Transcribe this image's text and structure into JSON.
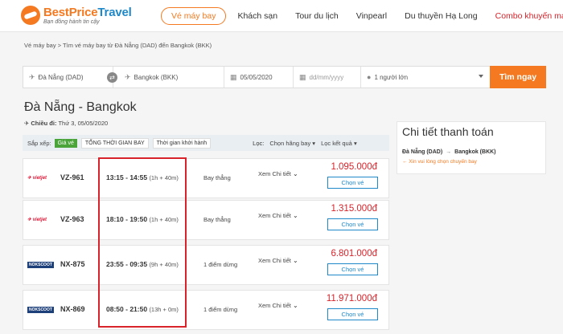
{
  "header": {
    "brand_main": "BestPrice",
    "brand_second": "Travel",
    "tagline": "Bạn đồng hành tin cậy",
    "nav": [
      "Vé máy bay",
      "Khách sạn",
      "Tour du lịch",
      "Vinpearl",
      "Du thuyền Hạ Long",
      "Combo khuyến mại"
    ]
  },
  "breadcrumb": {
    "home": "Vé máy bay",
    "sep": ">",
    "current": "Tìm vé máy bay từ Đà Nẵng (DAD) đến Bangkok (BKK)"
  },
  "search": {
    "from": "Đà Nẵng (DAD)",
    "to": "Bangkok (BKK)",
    "depart_date": "05/05/2020",
    "return_placeholder": "dd/mm/yyyy",
    "passengers": "1 người lớn",
    "button": "Tìm ngay"
  },
  "results": {
    "title": "Đà Nẵng - Bangkok",
    "depart_label": "Chiều đi:",
    "depart_date": "Thứ 3, 05/05/2020",
    "sort_label": "Sắp xếp:",
    "sort_price": "Giá vé",
    "sort_total_time": "TỔNG THỜI GIAN BAY",
    "sort_depart_time": "Thời gian khởi hành",
    "filter_label": "Lọc:",
    "filter_airline": "Chọn hãng bay",
    "filter_result": "Lọc kết quả",
    "flights": [
      {
        "airline": "vietjet",
        "code": "VZ-961",
        "depart": "13:15",
        "arrive": "14:55",
        "duration": "(1h + 40m)",
        "stops": "Bay thẳng",
        "details": "Xem Chi tiết",
        "price": "1.095.000đ",
        "button": "Chọn vé"
      },
      {
        "airline": "vietjet",
        "code": "VZ-963",
        "depart": "18:10",
        "arrive": "19:50",
        "duration": "(1h + 40m)",
        "stops": "Bay thẳng",
        "details": "Xem Chi tiết",
        "price": "1.315.000đ",
        "button": "Chọn vé"
      },
      {
        "airline": "NOKSCOOT",
        "code": "NX-875",
        "depart": "23:55",
        "arrive": "09:35",
        "duration": "(9h + 40m)",
        "stops": "1 điểm dừng",
        "details": "Xem Chi tiết",
        "price": "6.801.000đ",
        "button": "Chọn vé"
      },
      {
        "airline": "NOKSCOOT",
        "code": "NX-869",
        "depart": "08:50",
        "arrive": "21:50",
        "duration": "(13h + 0m)",
        "stops": "1 điểm dừng",
        "details": "Xem Chi tiết",
        "price": "11.971.000đ",
        "button": "Chọn vé"
      }
    ]
  },
  "payment": {
    "title": "Chi tiết thanh toán",
    "from": "Đà Nẵng (DAD)",
    "arrow": "→",
    "to": "Bangkok (BKK)",
    "note": "← Xin vui lòng chọn chuyến bay"
  },
  "colors": {
    "brand_orange": "#f47920",
    "brand_blue": "#1e88c9",
    "price_red": "#d8232a",
    "sort_green": "#4aa43a"
  }
}
